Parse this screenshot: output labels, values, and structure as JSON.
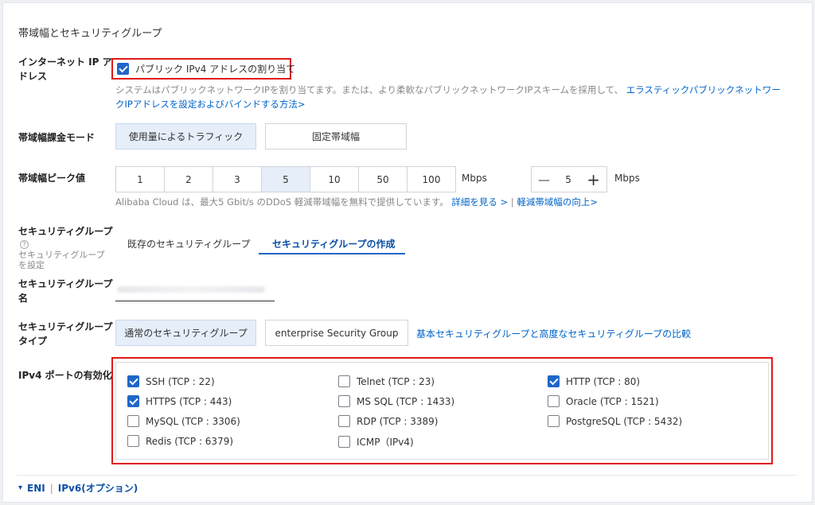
{
  "section": {
    "title": "帯域幅とセキュリティグループ"
  },
  "public_ip": {
    "label_line1": "インターネット IP ア",
    "label_line2": "ドレス",
    "checkbox_label": "パブリック IPv4 アドレスの割り当て",
    "checked": true,
    "desc_line1": "システムはパブリックネットワークIPを割り当てます。または、より柔軟なパブリックネットワークIPスキームを採用して、",
    "desc_link1": "エラスティックパブリックネットワー",
    "desc_link2": "クIPアドレスを設定およびバインドする方法>"
  },
  "billing": {
    "label": "帯域幅課金モード",
    "options": [
      "使用量によるトラフィック",
      "固定帯域幅"
    ],
    "selected": "使用量によるトラフィック"
  },
  "peak": {
    "label": "帯域幅ピーク値",
    "values": [
      "1",
      "2",
      "3",
      "5",
      "10",
      "50",
      "100"
    ],
    "selected": "5",
    "unit": "Mbps",
    "stepper_value": "5",
    "stepper_unit": "Mbps",
    "minus": "—",
    "plus": "+",
    "note": "Alibaba Cloud は、最大5 Gbit/s のDDoS 軽減帯域幅を無料で提供しています。",
    "link1": "詳細を見る >",
    "separator": "|",
    "link2": "軽減帯域幅の向上>"
  },
  "security_group": {
    "label": "セキュリティグループ",
    "help_icon": "?",
    "sub_line1": "セキュリティグループ",
    "sub_line2": "を設定",
    "tabs": [
      "既存のセキュリティグループ",
      "セキュリティグループの作成"
    ],
    "active_tab": "セキュリティグループの作成"
  },
  "sg_name": {
    "label_line1": "セキュリティグループ",
    "label_line2": "名",
    "value": ""
  },
  "sg_type": {
    "label_line1": "セキュリティグループ",
    "label_line2": "タイプ",
    "options": [
      "通常のセキュリティグループ",
      "enterprise Security Group"
    ],
    "selected": "通常のセキュリティグループ",
    "compare_link": "基本セキュリティグループと高度なセキュリティグループの比較"
  },
  "ports": {
    "label": "IPv4 ポートの有効化",
    "items": [
      {
        "label": "SSH (TCP : 22)",
        "checked": true
      },
      {
        "label": "Telnet (TCP : 23)",
        "checked": false
      },
      {
        "label": "HTTP (TCP : 80)",
        "checked": true
      },
      {
        "label": "HTTPS (TCP : 443)",
        "checked": true
      },
      {
        "label": "MS SQL (TCP : 1433)",
        "checked": false
      },
      {
        "label": "Oracle (TCP : 1521)",
        "checked": false
      },
      {
        "label": "MySQL (TCP : 3306)",
        "checked": false
      },
      {
        "label": "RDP (TCP : 3389)",
        "checked": false
      },
      {
        "label": "PostgreSQL (TCP : 5432)",
        "checked": false
      },
      {
        "label": "Redis (TCP : 6379)",
        "checked": false
      },
      {
        "label": "ICMP（IPv4)",
        "checked": false
      }
    ]
  },
  "footer": {
    "arrow": "▾",
    "eni": "ENI",
    "separator": "|",
    "ipv6": "IPv6(オプション)"
  },
  "colors": {
    "accent": "#1f66c9",
    "highlight": "#e01a1a",
    "link": "#0064c8",
    "selected_bg": "#e5eef9"
  }
}
